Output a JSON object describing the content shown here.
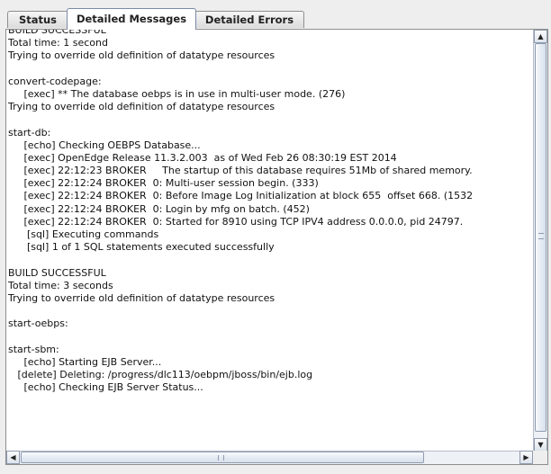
{
  "tabs": [
    {
      "label": "Status",
      "active": false
    },
    {
      "label": "Detailed Messages",
      "active": true
    },
    {
      "label": "Detailed Errors",
      "active": false
    }
  ],
  "log_lines": [
    "BUILD SUCCESSFUL",
    "Total time: 1 second",
    "Trying to override old definition of datatype resources",
    "",
    "convert-codepage:",
    "     [exec] ** The database oebps is in use in multi-user mode. (276)",
    "Trying to override old definition of datatype resources",
    "",
    "start-db:",
    "     [echo] Checking OEBPS Database...",
    "     [exec] OpenEdge Release 11.3.2.003  as of Wed Feb 26 08:30:19 EST 2014",
    "     [exec] 22:12:23 BROKER     The startup of this database requires 51Mb of shared memory.",
    "     [exec] 22:12:24 BROKER  0: Multi-user session begin. (333)",
    "     [exec] 22:12:24 BROKER  0: Before Image Log Initialization at block 655  offset 668. (1532",
    "     [exec] 22:12:24 BROKER  0: Login by mfg on batch. (452)",
    "     [exec] 22:12:24 BROKER  0: Started for 8910 using TCP IPV4 address 0.0.0.0, pid 24797.",
    "      [sql] Executing commands",
    "      [sql] 1 of 1 SQL statements executed successfully",
    "",
    "BUILD SUCCESSFUL",
    "Total time: 3 seconds",
    "Trying to override old definition of datatype resources",
    "",
    "start-oebps:",
    "",
    "start-sbm:",
    "     [echo] Starting EJB Server...",
    "   [delete] Deleting: /progress/dlc113/oebpm/jboss/bin/ejb.log",
    "     [echo] Checking EJB Server Status..."
  ],
  "icons": {
    "scroll_up": "▲",
    "scroll_down": "▼",
    "scroll_left": "◀",
    "scroll_right": "▶"
  },
  "colors": {
    "background": "#eeeeee",
    "text_area": "#ffffff",
    "scrollbar_track": "#eef1f6"
  }
}
